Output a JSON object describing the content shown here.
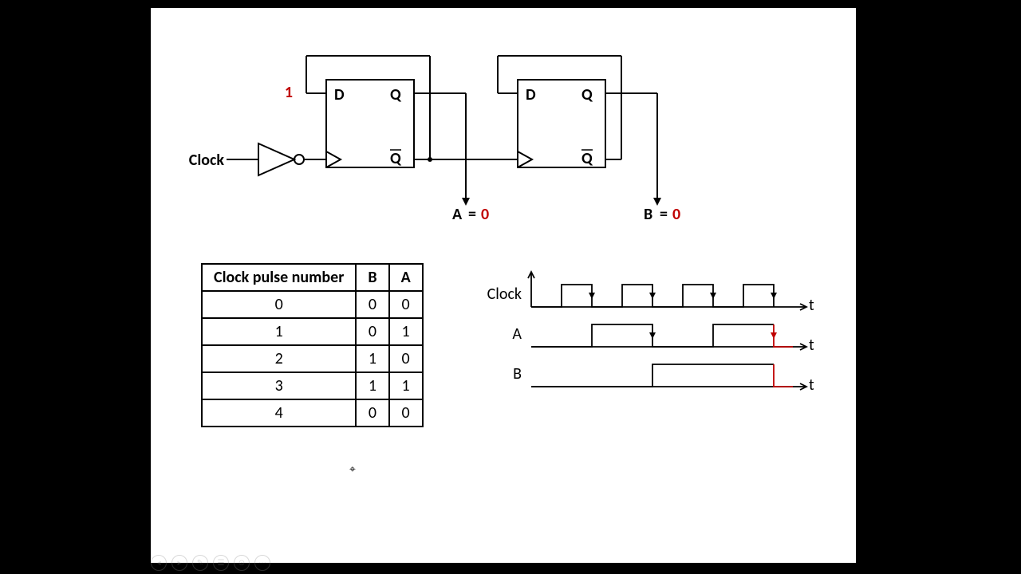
{
  "circuit": {
    "clock_label": "Clock",
    "d_input_value": "1",
    "ff1": {
      "D": "D",
      "Q": "Q",
      "Qbar": "Q"
    },
    "ff2": {
      "D": "D",
      "Q": "Q",
      "Qbar": "Q"
    },
    "out_a": {
      "name": "A",
      "eq": "=",
      "val": "0"
    },
    "out_b": {
      "name": "B",
      "eq": "=",
      "val": "0"
    }
  },
  "table": {
    "headers": [
      "Clock pulse number",
      "B",
      "A"
    ],
    "rows": [
      [
        "0",
        "0",
        "0"
      ],
      [
        "1",
        "0",
        "1"
      ],
      [
        "2",
        "1",
        "0"
      ],
      [
        "3",
        "1",
        "1"
      ],
      [
        "4",
        "0",
        "0"
      ]
    ]
  },
  "timing": {
    "signals": [
      "Clock",
      "A",
      "B"
    ],
    "axis": "t"
  },
  "chart_data": {
    "type": "table",
    "description": "2-bit asynchronous (ripple) up-counter from two D flip-flops (Qbar→D feedback, inverted clock cascading), state table and timing waveforms",
    "state_table": {
      "columns": [
        "Clock pulse number",
        "B",
        "A"
      ],
      "rows": [
        [
          0,
          0,
          0
        ],
        [
          1,
          0,
          1
        ],
        [
          2,
          1,
          0
        ],
        [
          3,
          1,
          1
        ],
        [
          4,
          0,
          0
        ]
      ]
    },
    "waveforms": {
      "time_unit": "clock half-periods (0..8 shown)",
      "Clock": [
        0,
        1,
        0,
        1,
        0,
        1,
        0,
        1,
        0
      ],
      "A": [
        0,
        0,
        1,
        1,
        0,
        0,
        1,
        1,
        0
      ],
      "B": [
        0,
        0,
        0,
        0,
        1,
        1,
        1,
        1,
        0
      ],
      "falling_edges_clock_at": [
        2,
        4,
        6,
        8
      ],
      "active_edge_highlight": {
        "signal": "A",
        "at": 8,
        "color": "#c00000"
      }
    }
  },
  "controls": {
    "buttons": [
      "prev",
      "next",
      "ink",
      "notes",
      "zoom",
      "more"
    ]
  }
}
